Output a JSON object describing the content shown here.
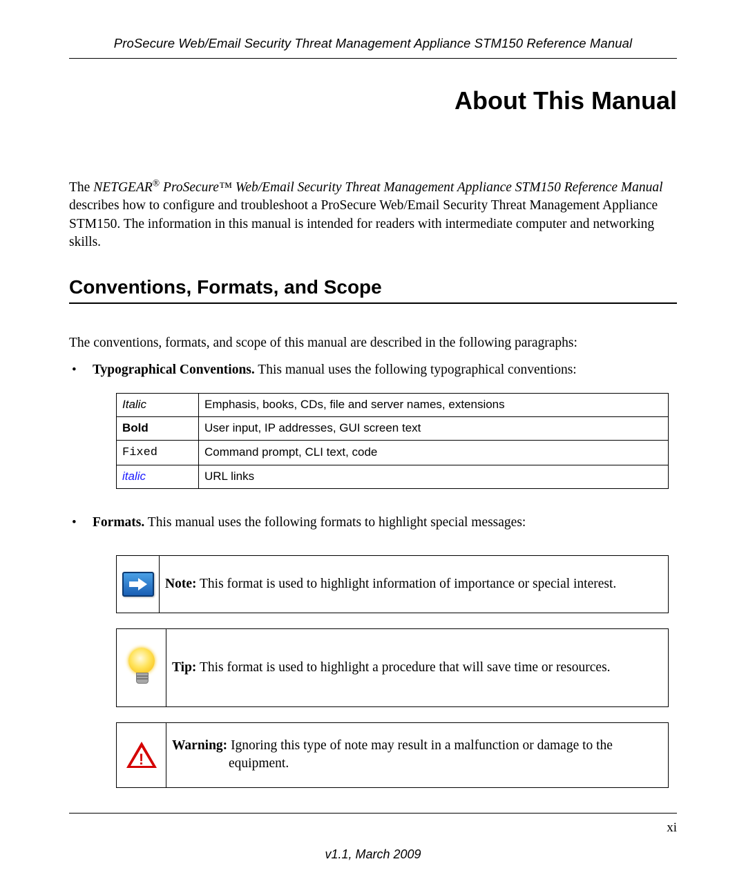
{
  "header": {
    "running": "ProSecure Web/Email Security Threat Management Appliance STM150 Reference Manual"
  },
  "title": "About This Manual",
  "intro": {
    "prefix": "The ",
    "brand": "NETGEAR",
    "reg": "®",
    "product_line": " ProSecure™ ",
    "rest_title": "Web/Email Security Threat Management Appliance STM150 Reference Manual",
    "body_rest": " describes how to configure and troubleshoot a ProSecure Web/Email Security Threat Management Appliance STM150. The information in this manual is intended for readers with intermediate computer and networking skills."
  },
  "section1": {
    "heading": "Conventions, Formats, and Scope",
    "lead": "The conventions, formats, and scope of this manual are described in the following paragraphs:"
  },
  "bullet_typo": {
    "label": "Typographical Conventions.",
    "rest": " This manual uses the following typographical conventions:"
  },
  "conv_table": [
    {
      "style": "italic",
      "label": "Italic",
      "desc": "Emphasis, books, CDs, file and server names, extensions"
    },
    {
      "style": "bold",
      "label": "Bold",
      "desc": "User input, IP addresses, GUI screen text"
    },
    {
      "style": "fixed",
      "label": "Fixed",
      "desc": "Command prompt, CLI text, code"
    },
    {
      "style": "link",
      "label": "italic",
      "desc": "URL links"
    }
  ],
  "bullet_formats": {
    "label": "Formats.",
    "rest": " This manual uses the following formats to highlight special messages:"
  },
  "callouts": {
    "note": {
      "label": "Note:",
      "text": " This format is used to highlight information of importance or special interest."
    },
    "tip": {
      "label": "Tip:",
      "text": " This format is used to highlight a procedure that will save time or resources."
    },
    "warning": {
      "label": "Warning:",
      "text": " Ignoring this type of note may result in a malfunction or damage to the equipment."
    }
  },
  "footer": {
    "folio": "xi",
    "version": "v1.1, March 2009"
  }
}
